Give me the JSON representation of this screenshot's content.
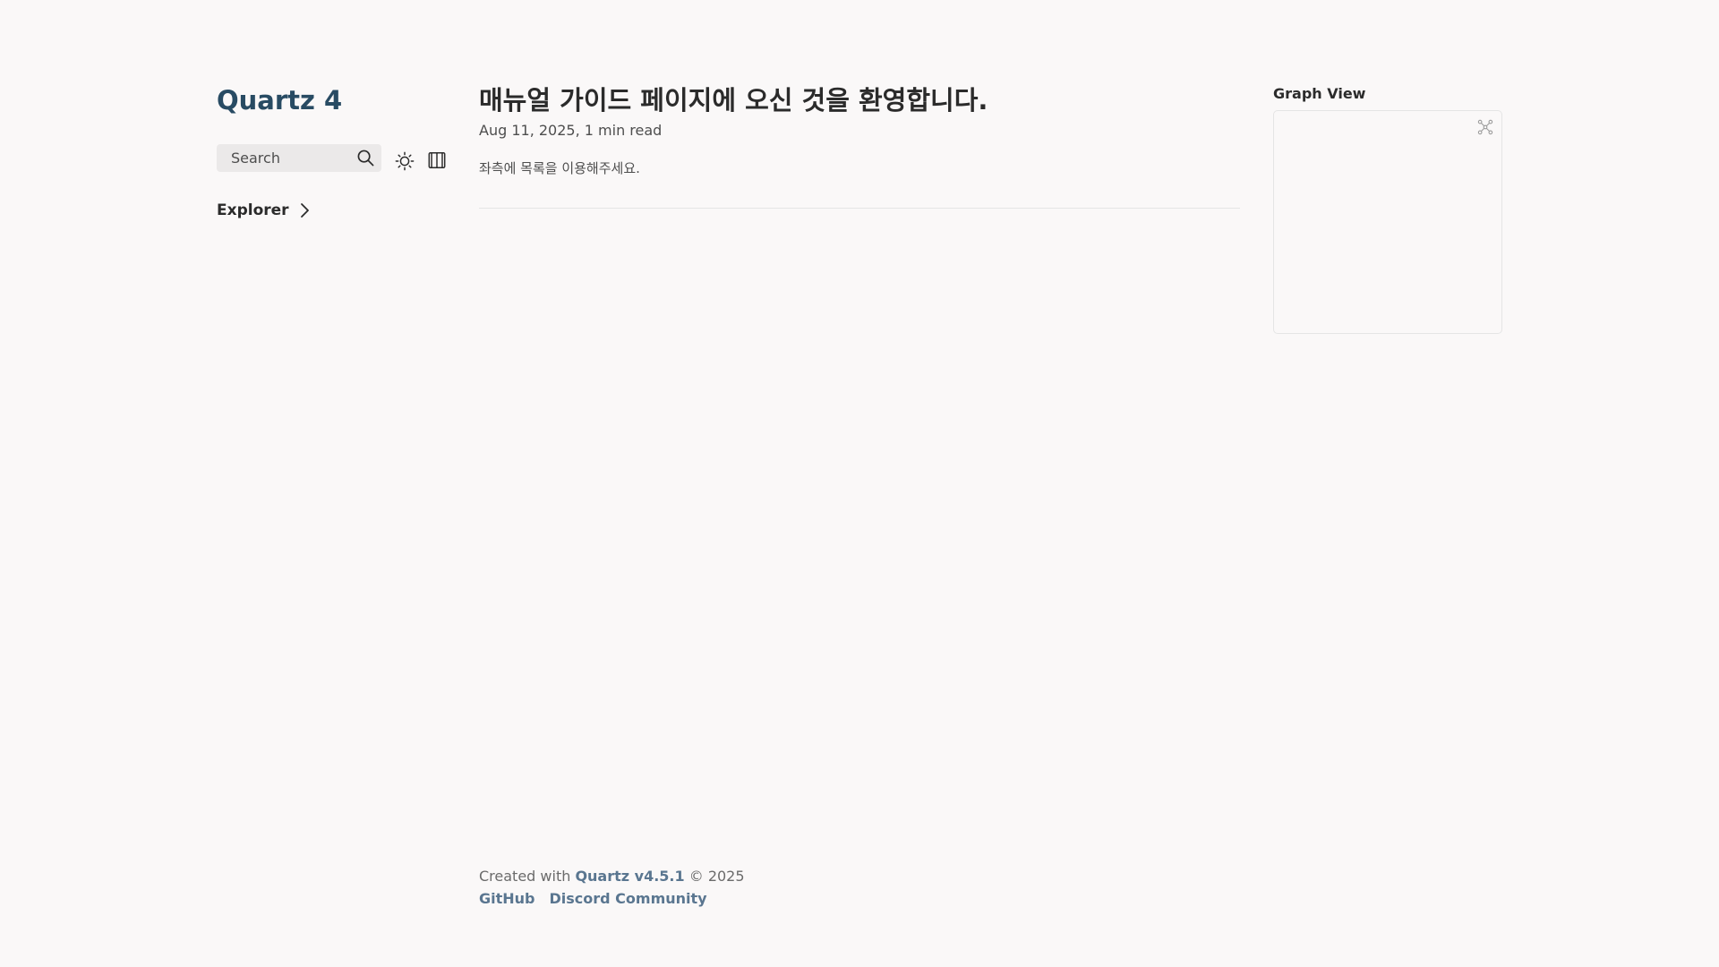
{
  "sidebar": {
    "site_title": "Quartz 4",
    "search": {
      "label": "Search"
    },
    "explorer": {
      "title": "Explorer"
    }
  },
  "article": {
    "title": "매뉴얼 가이드 페이지에 오신 것을 환영합니다.",
    "date": "Aug 11, 2025",
    "separator": ",",
    "reading_time": "1 min read",
    "body": "좌측에 목록을 이용해주세요."
  },
  "graph": {
    "title": "Graph View"
  },
  "footer": {
    "created_prefix": "Created with ",
    "quartz_link": "Quartz v4.5.1",
    "copyright": " © 2025",
    "links": [
      "GitHub",
      "Discord Community"
    ]
  },
  "colors": {
    "background": "#faf8f8",
    "site_title": "#284b63",
    "footer_link": "#5a7690",
    "search_bg": "#ebe9e9"
  },
  "icons": {
    "search": "search-icon",
    "darkmode": "sun-icon",
    "reader": "book-icon",
    "explorer": "chevron-right-icon",
    "graph": "global-graph-icon"
  }
}
